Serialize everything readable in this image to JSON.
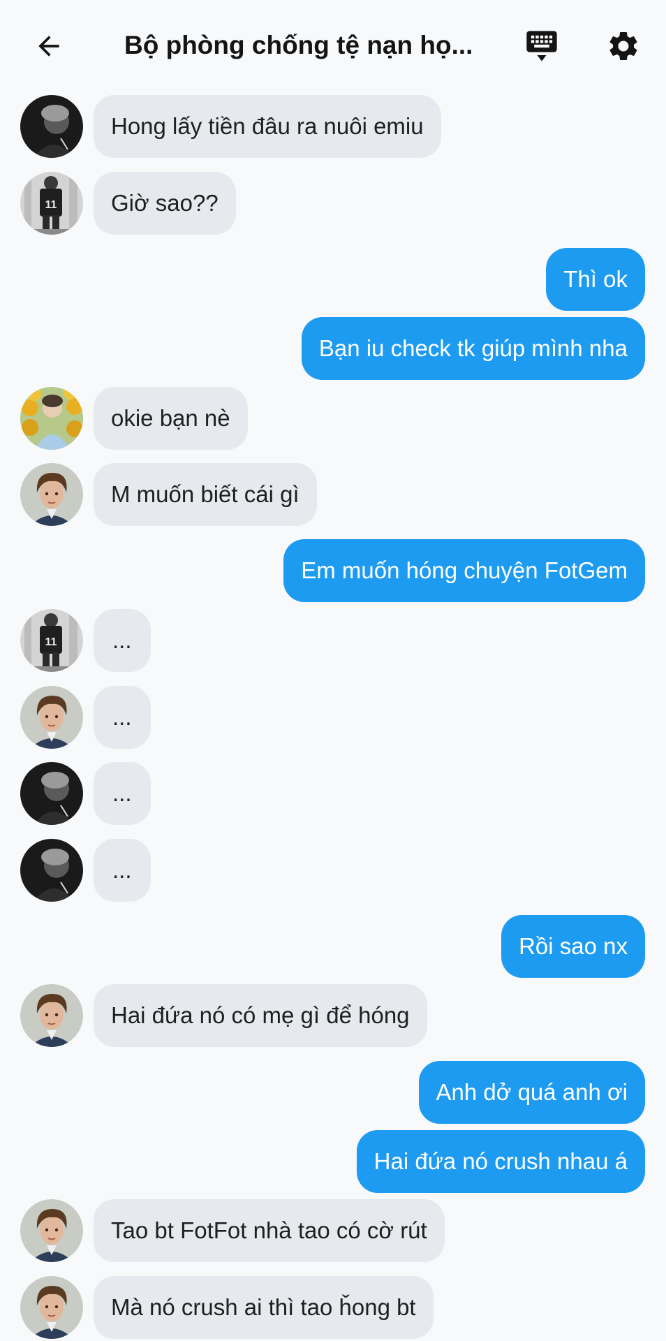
{
  "header": {
    "title": "Bộ phòng chống tệ nạn họ...",
    "back_icon": "arrow-left-icon",
    "keyboard_icon": "keyboard-icon",
    "settings_icon": "gear-icon"
  },
  "colors": {
    "outgoing_bubble": "#1d9bf0",
    "incoming_bubble": "#e6e9ed",
    "background": "#f8f9fb"
  },
  "messages": [
    {
      "direction": "in",
      "avatar": "avatar-dark-portrait",
      "text": "Hong lấy tiền đâu ra nuôi emiu"
    },
    {
      "direction": "in",
      "avatar": "avatar-jersey-11",
      "text": "Giờ sao??"
    },
    {
      "direction": "out",
      "text": "Thì ok"
    },
    {
      "direction": "out",
      "text": "Bạn iu check tk giúp mình nha"
    },
    {
      "direction": "in",
      "avatar": "avatar-sunflowers",
      "text": "okie bạn nè"
    },
    {
      "direction": "in",
      "avatar": "avatar-curly-hair",
      "text": "M muốn biết cái gì"
    },
    {
      "direction": "out",
      "text": "Em muốn hóng chuyện FotGem"
    },
    {
      "direction": "in",
      "avatar": "avatar-jersey-11",
      "text": "..."
    },
    {
      "direction": "in",
      "avatar": "avatar-curly-hair",
      "text": "..."
    },
    {
      "direction": "in",
      "avatar": "avatar-dark-portrait",
      "text": "..."
    },
    {
      "direction": "in",
      "avatar": "avatar-dark-portrait",
      "text": "..."
    },
    {
      "direction": "out",
      "text": "Rồi sao nx"
    },
    {
      "direction": "in",
      "avatar": "avatar-curly-hair",
      "text": "Hai đứa nó có mẹ gì để hóng"
    },
    {
      "direction": "out",
      "text": "Anh dở quá anh ơi"
    },
    {
      "direction": "out",
      "text": "Hai đứa nó crush nhau á"
    },
    {
      "direction": "in",
      "avatar": "avatar-curly-hair",
      "text": "Tao bt FotFot nhà tao có cờ rút"
    },
    {
      "direction": "in",
      "avatar": "avatar-curly-hair",
      "text": "Mà nó crush ai thì tao ȟong bt"
    }
  ]
}
